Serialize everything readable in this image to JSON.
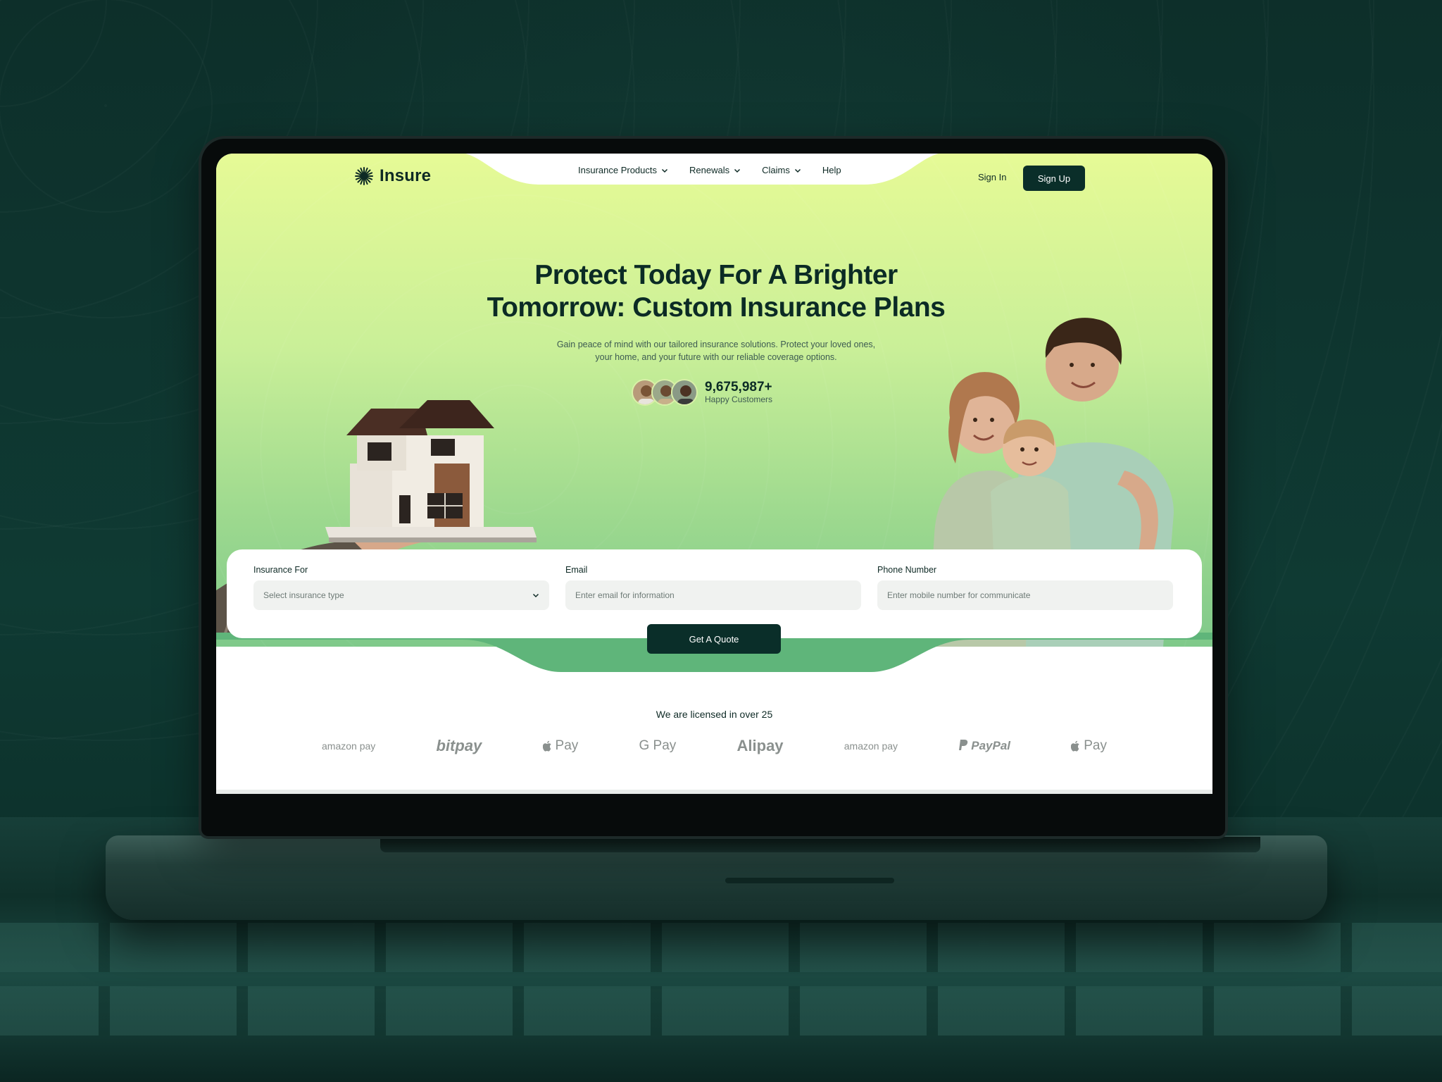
{
  "brand": {
    "name": "Insure"
  },
  "nav": {
    "items": [
      {
        "label": "Insurance Products",
        "has_dropdown": true
      },
      {
        "label": "Renewals",
        "has_dropdown": true
      },
      {
        "label": "Claims",
        "has_dropdown": true
      },
      {
        "label": "Help",
        "has_dropdown": false
      }
    ],
    "sign_in": "Sign In",
    "sign_up": "Sign Up"
  },
  "hero": {
    "title_line1": "Protect Today For A Brighter",
    "title_line2": "Tomorrow: Custom Insurance Plans",
    "subtitle_line1": "Gain peace of mind with our tailored insurance solutions. Protect your loved ones,",
    "subtitle_line2": "your home, and your future with our reliable coverage options.",
    "customers_count": "9,675,987+",
    "customers_label": "Happy Customers"
  },
  "form": {
    "insurance_for": {
      "label": "Insurance For",
      "placeholder": "Select insurance type"
    },
    "email": {
      "label": "Email",
      "placeholder": "Enter email for information"
    },
    "phone": {
      "label": "Phone Number",
      "placeholder": "Enter mobile number for communicate"
    },
    "submit": "Get A Quote"
  },
  "partners": {
    "heading": "We are licensed in over 25",
    "logos": [
      {
        "name": "amazon pay",
        "icon": "amazon-pay-logo"
      },
      {
        "name": "bitpay",
        "icon": "bitpay-logo"
      },
      {
        "name": "Pay",
        "icon": "apple-pay-logo"
      },
      {
        "name": "G Pay",
        "icon": "google-pay-logo"
      },
      {
        "name": "Alipay",
        "icon": "alipay-logo"
      },
      {
        "name": "amazon pay",
        "icon": "amazon-pay-logo"
      },
      {
        "name": "PayPal",
        "icon": "paypal-logo"
      },
      {
        "name": "Pay",
        "icon": "apple-pay-logo"
      }
    ]
  },
  "colors": {
    "brand_dark": "#0a2e29",
    "hero_top": "#e6fa96",
    "hero_bottom": "#7fc98a",
    "accent_green": "#5fb57a"
  }
}
